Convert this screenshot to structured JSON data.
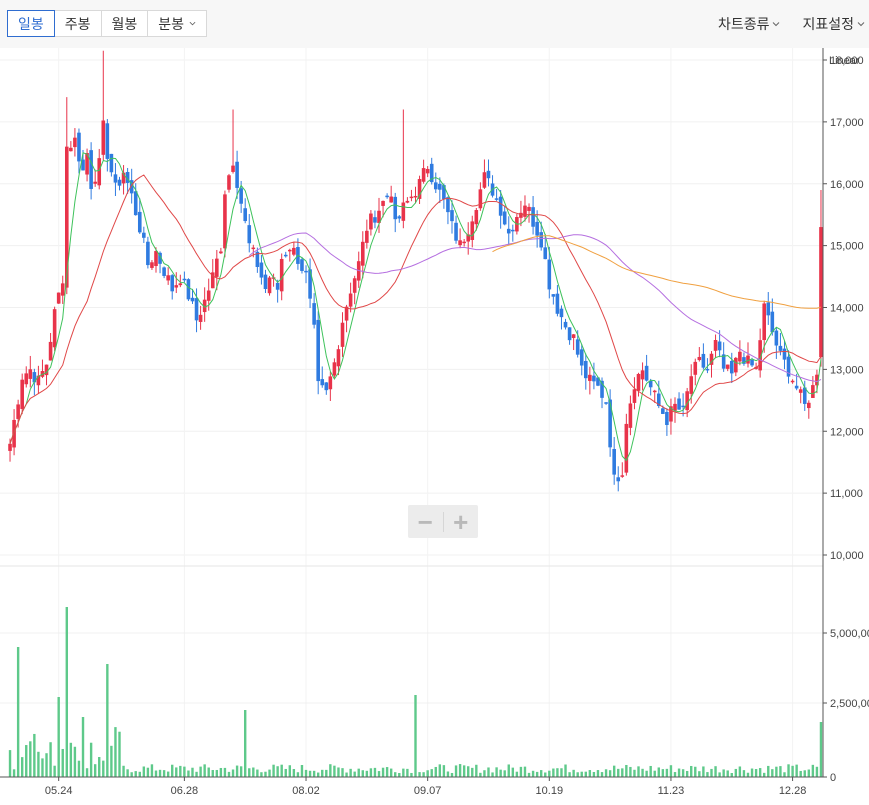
{
  "toolbar": {
    "tabs": [
      {
        "label": "일봉",
        "active": true
      },
      {
        "label": "주봉",
        "active": false
      },
      {
        "label": "월봉",
        "active": false
      },
      {
        "label": "분봉",
        "active": false,
        "dropdown": true
      }
    ],
    "menus": [
      {
        "label": "차트종류"
      },
      {
        "label": "지표설정"
      }
    ]
  },
  "zoom": {
    "minus": "−",
    "plus": "+"
  },
  "chart_data": {
    "type": "candlestick",
    "scale_label": "Linear",
    "colors": {
      "up": "#e8334a",
      "down": "#2f7be0",
      "volume": "#5ec98a",
      "ma5": "#3ec25b",
      "ma20": "#e04848",
      "ma60": "#b56fe0",
      "ma120": "#f0a040"
    },
    "price_axis": {
      "min": 10000,
      "max": 18000,
      "ticks": [
        "18,000",
        "17,000",
        "16,000",
        "15,000",
        "14,000",
        "13,000",
        "12,000",
        "11,000",
        "10,000"
      ]
    },
    "volume_axis": {
      "ticks": [
        "5,000,00",
        "2,500,00",
        "0"
      ]
    },
    "x_ticks": [
      "05.24",
      "06.28",
      "08.02",
      "09.07",
      "10.19",
      "11.23",
      "12.28"
    ],
    "anchors": [
      [
        0,
        11800
      ],
      [
        3,
        12900
      ],
      [
        5,
        13000
      ],
      [
        7,
        12800
      ],
      [
        9,
        13100
      ],
      [
        11,
        13900
      ],
      [
        13,
        14500
      ],
      [
        14,
        16600
      ],
      [
        16,
        16700
      ],
      [
        18,
        16200
      ],
      [
        19,
        16500
      ],
      [
        20,
        16000
      ],
      [
        22,
        16300
      ],
      [
        23,
        16900
      ],
      [
        24,
        16500
      ],
      [
        26,
        15900
      ],
      [
        28,
        16200
      ],
      [
        30,
        15800
      ],
      [
        32,
        15300
      ],
      [
        34,
        14700
      ],
      [
        36,
        14900
      ],
      [
        38,
        14600
      ],
      [
        40,
        14300
      ],
      [
        42,
        14500
      ],
      [
        44,
        14200
      ],
      [
        46,
        13800
      ],
      [
        48,
        14100
      ],
      [
        50,
        14500
      ],
      [
        52,
        15000
      ],
      [
        53,
        15900
      ],
      [
        55,
        16400
      ],
      [
        57,
        15700
      ],
      [
        59,
        15000
      ],
      [
        61,
        14700
      ],
      [
        63,
        14300
      ],
      [
        64,
        14500
      ],
      [
        66,
        14300
      ],
      [
        67,
        14800
      ],
      [
        69,
        15000
      ],
      [
        71,
        14800
      ],
      [
        73,
        14500
      ],
      [
        75,
        13600
      ],
      [
        76,
        12700
      ],
      [
        78,
        12600
      ],
      [
        80,
        13100
      ],
      [
        82,
        13800
      ],
      [
        84,
        14300
      ],
      [
        86,
        14700
      ],
      [
        88,
        15300
      ],
      [
        90,
        15500
      ],
      [
        92,
        15700
      ],
      [
        94,
        15900
      ],
      [
        95,
        15300
      ],
      [
        97,
        15600
      ],
      [
        99,
        15800
      ],
      [
        101,
        16000
      ],
      [
        103,
        16300
      ],
      [
        105,
        16000
      ],
      [
        107,
        15700
      ],
      [
        109,
        15300
      ],
      [
        111,
        15000
      ],
      [
        113,
        15300
      ],
      [
        115,
        15700
      ],
      [
        117,
        16100
      ],
      [
        119,
        15900
      ],
      [
        121,
        15600
      ],
      [
        123,
        15200
      ],
      [
        125,
        15500
      ],
      [
        127,
        15700
      ],
      [
        129,
        15400
      ],
      [
        131,
        15100
      ],
      [
        133,
        14400
      ],
      [
        135,
        14000
      ],
      [
        137,
        13700
      ],
      [
        139,
        13500
      ],
      [
        141,
        13000
      ],
      [
        143,
        12800
      ],
      [
        145,
        12700
      ],
      [
        147,
        12500
      ],
      [
        149,
        11200
      ],
      [
        151,
        11400
      ],
      [
        152,
        12200
      ],
      [
        154,
        12800
      ],
      [
        156,
        13000
      ],
      [
        158,
        12700
      ],
      [
        160,
        12400
      ],
      [
        162,
        12200
      ],
      [
        164,
        12400
      ],
      [
        166,
        12300
      ],
      [
        168,
        12900
      ],
      [
        170,
        13100
      ],
      [
        172,
        13000
      ],
      [
        174,
        13400
      ],
      [
        176,
        13000
      ],
      [
        178,
        12900
      ],
      [
        180,
        13300
      ],
      [
        182,
        13100
      ],
      [
        184,
        13000
      ],
      [
        186,
        14000
      ],
      [
        188,
        13600
      ],
      [
        190,
        13200
      ],
      [
        192,
        13000
      ],
      [
        194,
        12700
      ],
      [
        196,
        12400
      ],
      [
        198,
        12700
      ],
      [
        199,
        13000
      ],
      [
        200,
        15300
      ]
    ],
    "ma_windows": [
      5,
      20,
      60,
      120
    ]
  }
}
